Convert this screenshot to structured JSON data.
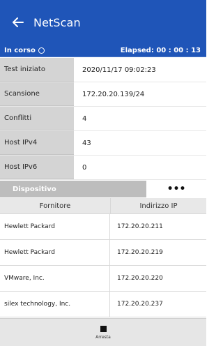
{
  "app": {
    "title": "NetScan"
  },
  "status": {
    "state": "In corso",
    "elapsed": "Elapsed: 00 : 00 : 13"
  },
  "info": {
    "rows": [
      {
        "label": "Test iniziato",
        "value": "2020/11/17 09:02:23"
      },
      {
        "label": "Scansione",
        "value": "172.20.20.139/24"
      },
      {
        "label": "Conflitti",
        "value": "4"
      },
      {
        "label": "Host IPv4",
        "value": "43"
      },
      {
        "label": "Host IPv6",
        "value": "0"
      }
    ]
  },
  "device": {
    "label": "Dispositivo",
    "more": "•••"
  },
  "table": {
    "headers": [
      "Fornitore",
      "Indirizzo IP"
    ],
    "rows": [
      [
        "Hewlett Packard",
        "172.20.20.211"
      ],
      [
        "Hewlett Packard",
        "172.20.20.219"
      ],
      [
        "VMware, Inc.",
        "172.20.20.220"
      ],
      [
        "silex technology, Inc.",
        "172.20.20.237"
      ]
    ]
  },
  "bottom": {
    "stop_label": "Arresta"
  },
  "colors": {
    "brand_blue": "#1f55b8"
  }
}
